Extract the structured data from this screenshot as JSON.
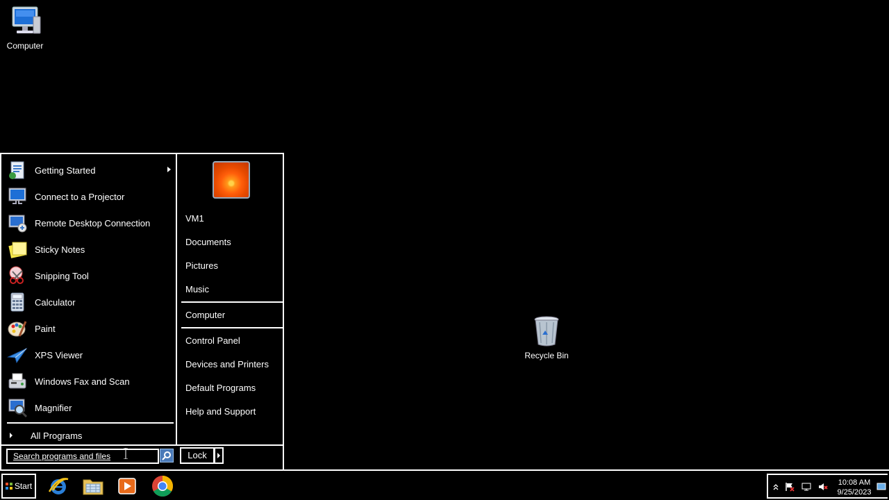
{
  "desktop": {
    "icons": [
      {
        "label": "Computer",
        "icon": "computer-icon"
      },
      {
        "label": "Recycle Bin",
        "icon": "recycle-bin-icon"
      }
    ]
  },
  "start_menu": {
    "programs": [
      {
        "label": "Getting Started",
        "icon": "getting-started-icon",
        "has_submenu": true
      },
      {
        "label": "Connect to a Projector",
        "icon": "projector-icon"
      },
      {
        "label": "Remote Desktop Connection",
        "icon": "remote-desktop-icon"
      },
      {
        "label": "Sticky Notes",
        "icon": "sticky-notes-icon"
      },
      {
        "label": "Snipping Tool",
        "icon": "snipping-tool-icon"
      },
      {
        "label": "Calculator",
        "icon": "calculator-icon"
      },
      {
        "label": "Paint",
        "icon": "paint-icon"
      },
      {
        "label": "XPS Viewer",
        "icon": "xps-viewer-icon"
      },
      {
        "label": "Windows Fax and Scan",
        "icon": "fax-scan-icon"
      },
      {
        "label": "Magnifier",
        "icon": "magnifier-icon"
      }
    ],
    "all_programs_label": "All Programs",
    "search": {
      "placeholder": "Search programs and files",
      "value": ""
    },
    "places": [
      {
        "label": "VM1"
      },
      {
        "label": "Documents"
      },
      {
        "label": "Pictures"
      },
      {
        "label": "Music"
      },
      {
        "label": "Computer"
      },
      {
        "label": "Control Panel"
      },
      {
        "label": "Devices and Printers"
      },
      {
        "label": "Default Programs"
      },
      {
        "label": "Help and Support"
      }
    ],
    "lock_label": "Lock"
  },
  "taskbar": {
    "start_label": "Start",
    "pinned": [
      {
        "icon": "internet-explorer-icon"
      },
      {
        "icon": "file-explorer-icon"
      },
      {
        "icon": "media-player-icon"
      },
      {
        "icon": "chrome-icon"
      }
    ],
    "tray": {
      "icons": [
        "show-hidden-icons-arrow",
        "action-center-flag-icon",
        "network-icon",
        "volume-muted-icon"
      ],
      "time": "10:08 AM",
      "date": "9/25/2023"
    }
  },
  "colors": {
    "background": "#000000",
    "foreground": "#ffffff",
    "search_button": "#4a7ab8"
  }
}
